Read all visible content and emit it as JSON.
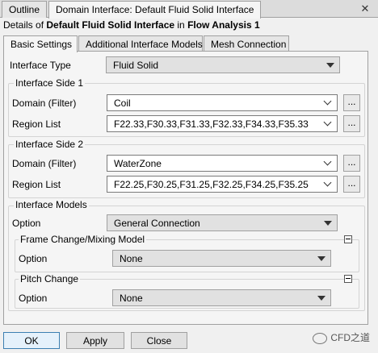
{
  "tabs": [
    "Outline",
    "Domain Interface: Default Fluid Solid Interface"
  ],
  "details": {
    "prefix": "Details of ",
    "object": "Default Fluid Solid Interface",
    "middle": " in ",
    "analysis": "Flow Analysis 1"
  },
  "subtabs": [
    "Basic Settings",
    "Additional Interface Models",
    "Mesh Connection"
  ],
  "interface_type": {
    "label": "Interface Type",
    "value": "Fluid Solid"
  },
  "side1": {
    "title": "Interface Side 1",
    "domain_label": "Domain (Filter)",
    "domain_value": "Coil",
    "region_label": "Region List",
    "region_value": "F22.33,F30.33,F31.33,F32.33,F34.33,F35.33"
  },
  "side2": {
    "title": "Interface Side 2",
    "domain_label": "Domain (Filter)",
    "domain_value": "WaterZone",
    "region_label": "Region List",
    "region_value": "F22.25,F30.25,F31.25,F32.25,F34.25,F35.25"
  },
  "models": {
    "title": "Interface Models",
    "option_label": "Option",
    "option_value": "General Connection",
    "frame_change": {
      "title": "Frame Change/Mixing Model",
      "option_label": "Option",
      "option_value": "None"
    },
    "pitch_change": {
      "title": "Pitch Change",
      "option_label": "Option",
      "option_value": "None"
    }
  },
  "ellipsis": "...",
  "close_glyph": "✕",
  "buttons": {
    "ok": "OK",
    "apply": "Apply",
    "close": "Close"
  },
  "watermark": "CFD之道"
}
